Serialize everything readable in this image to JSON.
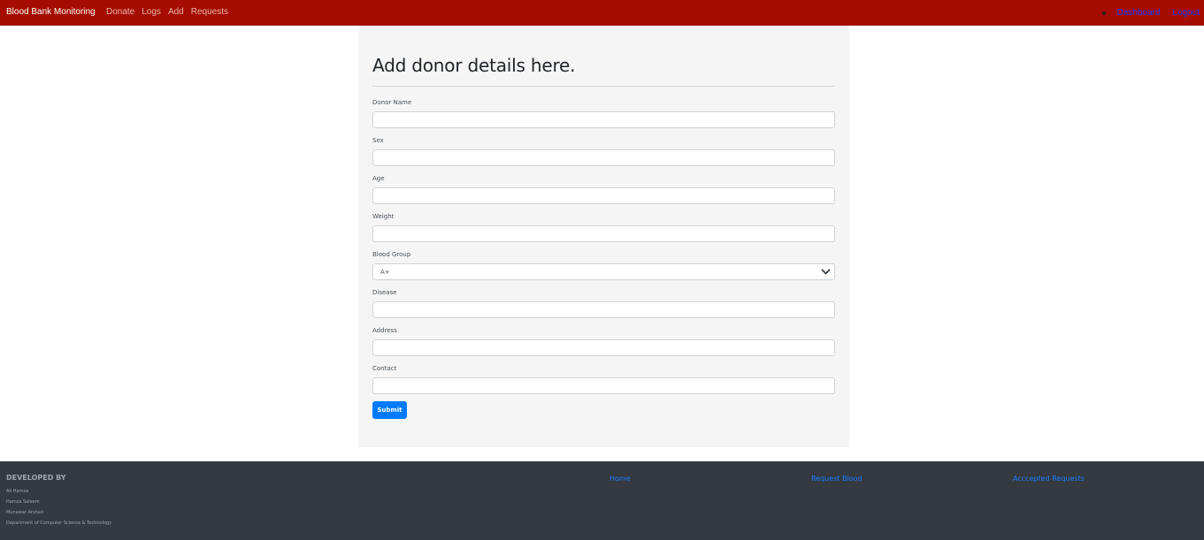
{
  "navbar": {
    "brand": "Blood Bank Monitoring",
    "links": [
      "Donate",
      "Logs",
      "Add",
      "Requests"
    ],
    "right_links": [
      "Dashboard",
      "Logout"
    ],
    "colors": {
      "background": "#a50d00",
      "right_link": "#1a3cff"
    }
  },
  "form": {
    "title": "Add donor details here.",
    "fields": {
      "donor_name": {
        "label": "Donor Name",
        "value": ""
      },
      "sex": {
        "label": "Sex",
        "value": ""
      },
      "age": {
        "label": "Age",
        "value": ""
      },
      "weight": {
        "label": "Weight",
        "value": ""
      },
      "blood_group": {
        "label": "Blood Group",
        "value": "A+"
      },
      "disease": {
        "label": "Disease",
        "value": ""
      },
      "address": {
        "label": "Address",
        "value": ""
      },
      "contact": {
        "label": "Contact",
        "value": ""
      }
    },
    "submit_label": "Submit",
    "colors": {
      "submit": "#007bff"
    }
  },
  "footer": {
    "developed_by_title": "DEVELOPED BY",
    "developers": [
      "Ali Hamza",
      "Hamza Saleem",
      "Munawar Arshad",
      "Department of Computer Science & Technology"
    ],
    "links": [
      "Home",
      "Request Blood",
      "Acccepted Requests"
    ],
    "colors": {
      "background": "#343a40",
      "link": "#1a7cff"
    }
  },
  "icons": {
    "select_chevron": "chevron-down-icon",
    "nav_bullet": "bullet-dot-icon"
  }
}
